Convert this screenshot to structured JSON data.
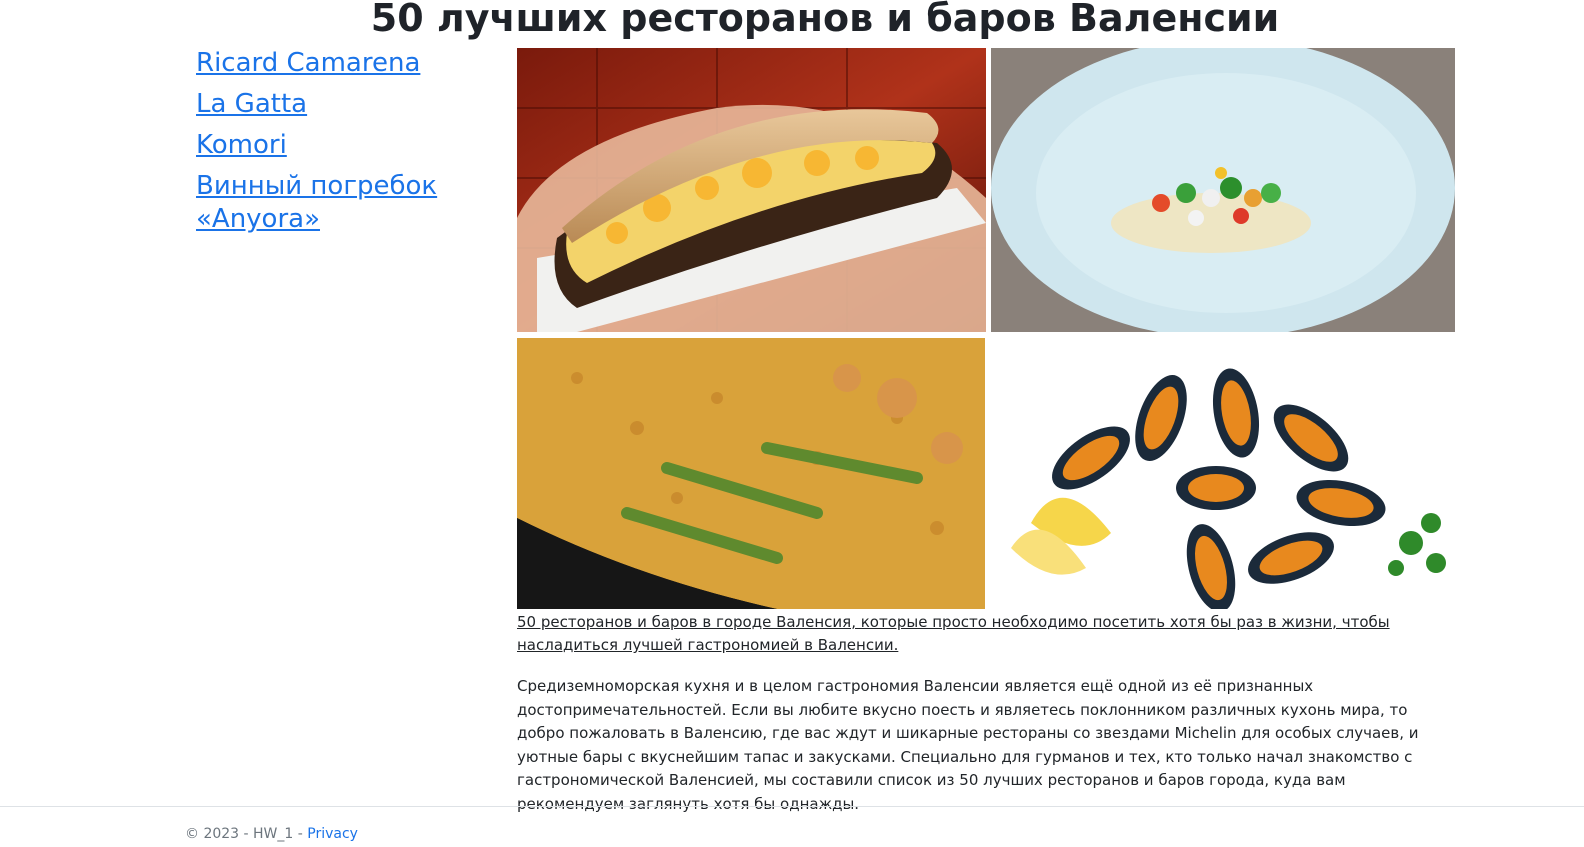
{
  "page": {
    "title": "50 лучших ресторанов и баров Валенсии"
  },
  "sidebar": {
    "links": [
      {
        "label": "Ricard  Camarena"
      },
      {
        "label": "La Gatta"
      },
      {
        "label": "Komori"
      },
      {
        "label": "Винный погребок «Anyora»"
      }
    ]
  },
  "gallery": {
    "images": [
      {
        "name": "sandwich-photo"
      },
      {
        "name": "plated-dish-photo"
      },
      {
        "name": "paella-photo"
      },
      {
        "name": "mussels-photo"
      }
    ]
  },
  "content": {
    "caption_link": "50 ресторанов и баров в городе Валенсия, которые просто необходимо посетить хотя бы раз в жизни, чтобы насладиться лучшей гастрономией в Валенсии.",
    "description": "Средиземноморская кухня и в целом гастрономия Валенсии является ещё одной из её признанных достопримечательностей. Если вы любите вкусно поесть и являетесь поклонником различных кухонь мира, то добро пожаловать в Валенсию, где вас ждут и шикарные рестораны со звездами Michelin для особых случаев, и уютные бары с вкуснейшим тапас и закусками. Специально для гурманов и тех, кто только начал знакомство с гастрономической Валенсией, мы составили список из 50 лучших ресторанов и баров города, куда вам рекомендуем заглянуть хотя бы однажды."
  },
  "footer": {
    "copyright": "© 2023 - HW_1 -",
    "privacy_label": "Privacy"
  },
  "colors": {
    "link": "#1a73e8",
    "text": "#212529",
    "divider": "#dee2e6"
  }
}
